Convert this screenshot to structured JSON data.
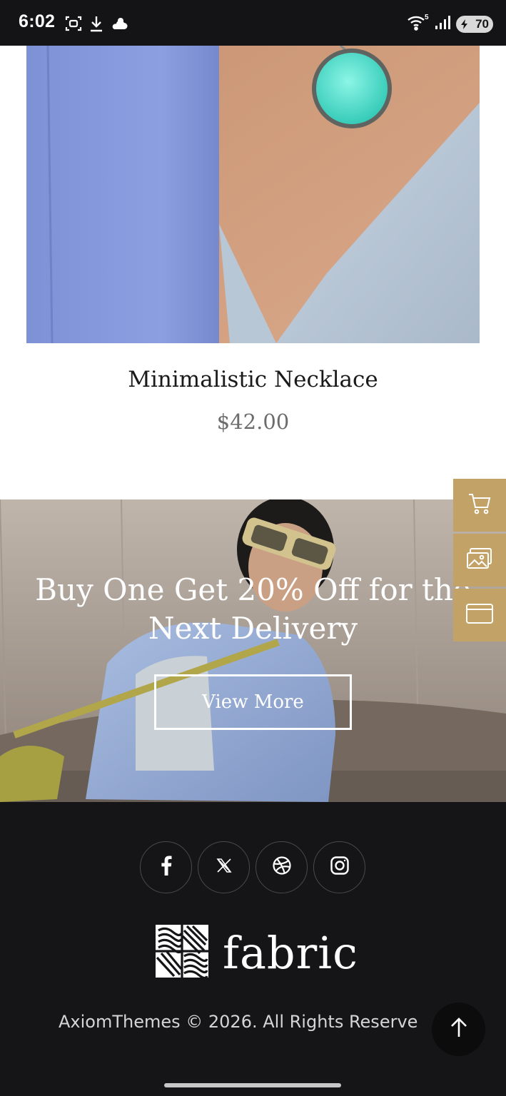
{
  "status_bar": {
    "time": "6:02",
    "battery": "70",
    "network_generation": "5"
  },
  "product": {
    "name": "Minimalistic Necklace",
    "price": "$42.00"
  },
  "promo": {
    "headline_line1": "Buy One Get 20% Off for the",
    "headline_line2": "Next Delivery",
    "button_label": "View More"
  },
  "side_actions": {
    "items": [
      "cart-icon",
      "gallery-icon",
      "browser-window-icon"
    ]
  },
  "footer": {
    "social": [
      "facebook-icon",
      "x-icon",
      "dribbble-icon",
      "instagram-icon"
    ],
    "brand_name": "fabric",
    "copyright": "AxiomThemes © 2026. All Rights Reserve"
  },
  "colors": {
    "accent": "#c2a267",
    "footer_bg": "#151517",
    "status_bar_bg": "#141416"
  }
}
